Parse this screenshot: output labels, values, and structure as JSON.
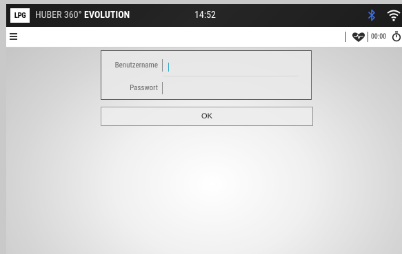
{
  "statusbar": {
    "logo": "LPG",
    "title_light": "HUBER 360°",
    "title_bold": "EVOLUTION",
    "time": "14:52",
    "icons": [
      "bluetooth-icon",
      "wifi-icon"
    ],
    "bluetooth_color": "#3d6ee6"
  },
  "toolbar": {
    "menu_icon": "menu-icon",
    "heart_icon": "heart-rate-icon",
    "timer": "00:00",
    "timer_icon": "stopwatch-icon"
  },
  "login": {
    "username_label": "Benutzername",
    "username_value": "",
    "password_label": "Passwort",
    "password_value": "",
    "ok_label": "OK"
  },
  "colors": {
    "statusbar_bg": "#1f1f1f",
    "caret": "#2aa7c9"
  }
}
